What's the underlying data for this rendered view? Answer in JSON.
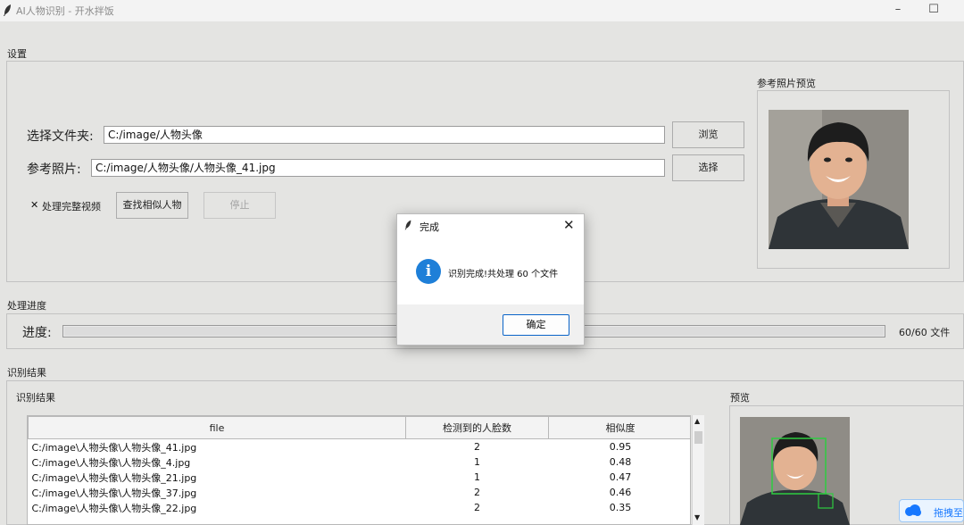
{
  "window": {
    "title": "AI人物识别 - 开水拌饭"
  },
  "settings": {
    "group_label": "设置",
    "folder_label": "选择文件夹:",
    "folder_value": "C:/image/人物头像",
    "browse_label": "浏览",
    "ref_label": "参考照片:",
    "ref_value": "C:/image/人物头像/人物头像_41.jpg",
    "select_label": "选择",
    "checkbox_label": "处理完整视频",
    "checkbox_checked": true,
    "find_button": "查找相似人物",
    "stop_button": "停止",
    "ref_preview_label": "参考照片预览"
  },
  "progress": {
    "group_label": "处理进度",
    "label": "进度:",
    "value": 1.0,
    "count_text": "60/60 文件"
  },
  "results": {
    "group_label": "识别结果",
    "sub_label": "识别结果",
    "columns": [
      "file",
      "检测到的人脸数",
      "相似度"
    ],
    "rows": [
      [
        "C:/image\\人物头像\\人物头像_41.jpg",
        "2",
        "0.95"
      ],
      [
        "C:/image\\人物头像\\人物头像_4.jpg",
        "1",
        "0.48"
      ],
      [
        "C:/image\\人物头像\\人物头像_21.jpg",
        "1",
        "0.47"
      ],
      [
        "C:/image\\人物头像\\人物头像_37.jpg",
        "2",
        "0.46"
      ],
      [
        "C:/image\\人物头像\\人物头像_22.jpg",
        "2",
        "0.35"
      ]
    ],
    "preview_label": "预览"
  },
  "dialog": {
    "title": "完成",
    "message": "识别完成!共处理 60 个文件",
    "ok_label": "确定"
  },
  "overlay": {
    "label": "拖拽至"
  },
  "colors": {
    "accent": "#1e7fd8",
    "face_box": "#2ecc40",
    "page_bg": "#e4e4e2"
  }
}
